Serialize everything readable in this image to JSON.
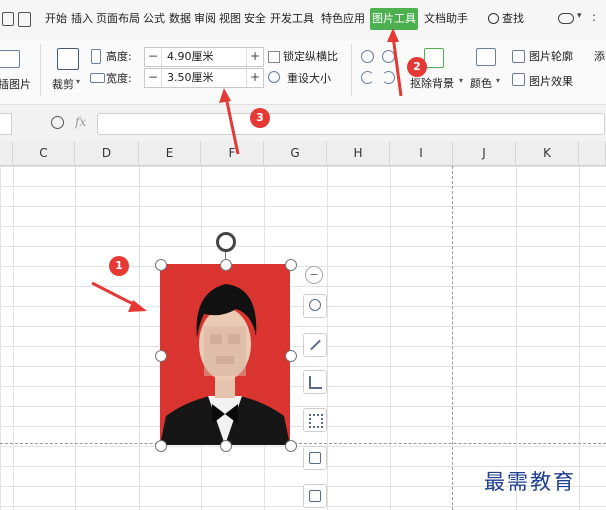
{
  "menu": {
    "tabs": [
      "开始",
      "插入",
      "页面布局",
      "公式",
      "数据",
      "审阅",
      "视图",
      "安全",
      "开发工具",
      "特色应用",
      "图片工具",
      "文档助手"
    ],
    "active_tab": "图片工具",
    "search_label": "查找"
  },
  "ribbon": {
    "left_cut_label": "插图片",
    "crop_label": "裁剪",
    "height_label": "高度:",
    "height_value": "4.90厘米",
    "width_label": "宽度:",
    "width_value": "3.50厘米",
    "lock_ratio_label": "锁定纵横比",
    "reset_size_label": "重设大小",
    "remove_bg_label": "抠除背景",
    "color_label": "颜色",
    "outline_label": "图片轮廓",
    "effects_label": "图片效果",
    "right_cut_label": "添"
  },
  "formula_bar": {
    "fx_label": "fx"
  },
  "columns": [
    "C",
    "D",
    "E",
    "F",
    "G",
    "H",
    "I",
    "J",
    "K"
  ],
  "badges": {
    "b1": "1",
    "b2": "2",
    "b3": "3"
  },
  "colors": {
    "active_tab": "#4caf50",
    "photo_bg": "#d9342f",
    "badge": "#e53935",
    "watermark": "#1f3f8f"
  },
  "icons": [
    "search-icon",
    "crop-icon",
    "height-icon",
    "width-icon",
    "remove-background-icon",
    "color-icon",
    "picture-outline-icon",
    "picture-effects-icon",
    "zoom-icon",
    "rotate-icon",
    "minus-icon",
    "zoom-in-icon",
    "edit-icon",
    "crop-tool-icon",
    "fill-icon",
    "convert-icon"
  ],
  "watermark": "最需教育"
}
